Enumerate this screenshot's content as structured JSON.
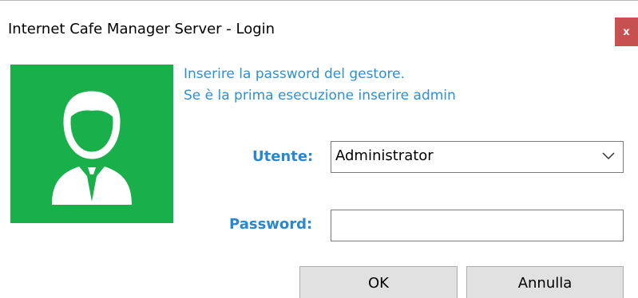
{
  "window": {
    "title": "Internet Cafe Manager Server - Login",
    "close_glyph": "x"
  },
  "avatar": {
    "icon": "user-avatar-icon",
    "background": "#19b04b"
  },
  "info": {
    "line1": "Inserire la password del gestore.",
    "line2": "Se è la prima esecuzione inserire admin"
  },
  "form": {
    "user_label": "Utente:",
    "user_value": "Administrator",
    "password_label": "Password:",
    "password_value": ""
  },
  "buttons": {
    "ok_label": "OK",
    "cancel_label": "Annulla"
  },
  "colors": {
    "accent_text": "#2e8fd4",
    "label_text": "#2a87cf",
    "close_button": "#c75050",
    "button_face": "#e1e1e1"
  }
}
